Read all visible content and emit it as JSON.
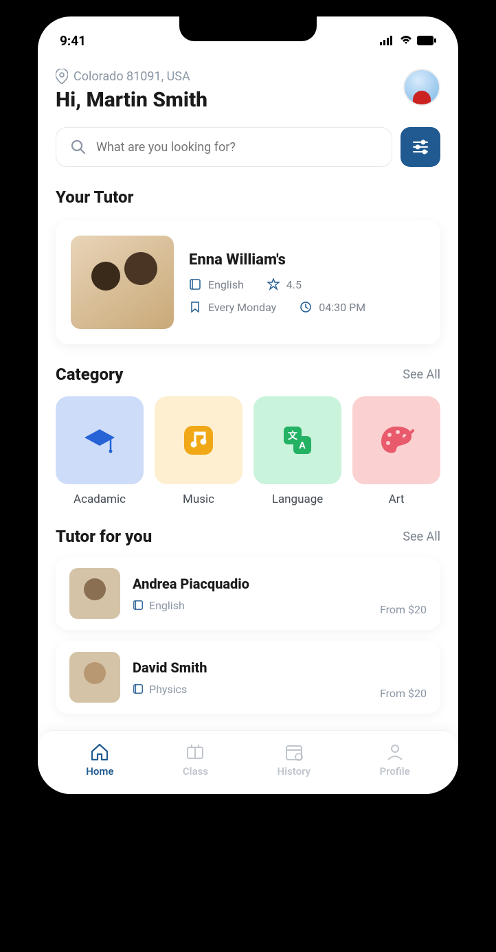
{
  "status": {
    "time": "9:41"
  },
  "header": {
    "location": "Colorado 81091, USA",
    "greeting": "Hi, Martin Smith"
  },
  "search": {
    "placeholder": "What are you looking for?"
  },
  "your_tutor": {
    "title": "Your Tutor",
    "name": "Enna William's",
    "subject": "English",
    "rating": "4.5",
    "schedule": "Every Monday",
    "time": "04:30 PM"
  },
  "category": {
    "title": "Category",
    "see_all": "See All",
    "items": [
      {
        "label": "Acadamic"
      },
      {
        "label": "Music"
      },
      {
        "label": "Language"
      },
      {
        "label": "Art"
      }
    ]
  },
  "tutor_for_you": {
    "title": "Tutor for you",
    "see_all": "See All",
    "items": [
      {
        "name": "Andrea Piacquadio",
        "subject": "English",
        "price": "From $20"
      },
      {
        "name": "David Smith",
        "subject": "Physics",
        "price": "From $20"
      }
    ]
  },
  "nav": {
    "home": "Home",
    "class": "Class",
    "history": "History",
    "profile": "Profile"
  }
}
